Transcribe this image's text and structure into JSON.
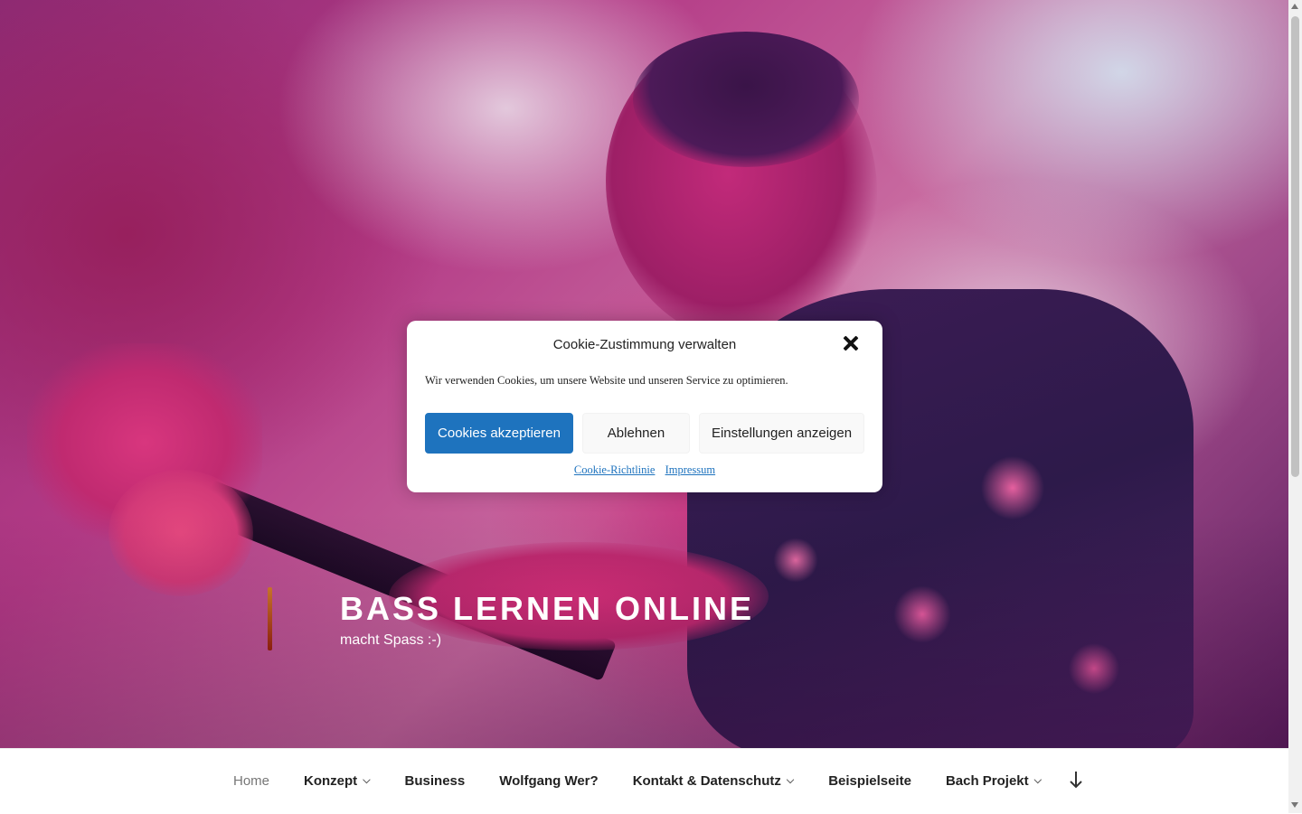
{
  "site": {
    "title": "BASS LERNEN ONLINE",
    "description": "macht Spass :-)"
  },
  "nav": {
    "items": [
      {
        "label": "Home",
        "active": true,
        "has_submenu": false
      },
      {
        "label": "Konzept",
        "active": false,
        "has_submenu": true
      },
      {
        "label": "Business",
        "active": false,
        "has_submenu": false
      },
      {
        "label": "Wolfgang Wer?",
        "active": false,
        "has_submenu": false
      },
      {
        "label": "Kontakt & Datenschutz",
        "active": false,
        "has_submenu": true
      },
      {
        "label": "Beispielseite",
        "active": false,
        "has_submenu": false
      },
      {
        "label": "Bach Projekt",
        "active": false,
        "has_submenu": true
      }
    ],
    "scroll_icon": "arrow-down-icon"
  },
  "cookie": {
    "title": "Cookie-Zustimmung verwalten",
    "text": "Wir verwenden Cookies, um unsere Website und unseren Service zu optimieren.",
    "accept_label": "Cookies akzeptieren",
    "deny_label": "Ablehnen",
    "prefs_label": "Einstellungen anzeigen",
    "policy_link": "Cookie-Richtlinie",
    "imprint_link": "Impressum",
    "close_icon": "close-icon"
  },
  "colors": {
    "accent": "#1e73be",
    "nav_active": "#767676",
    "nav_text": "#222222"
  }
}
